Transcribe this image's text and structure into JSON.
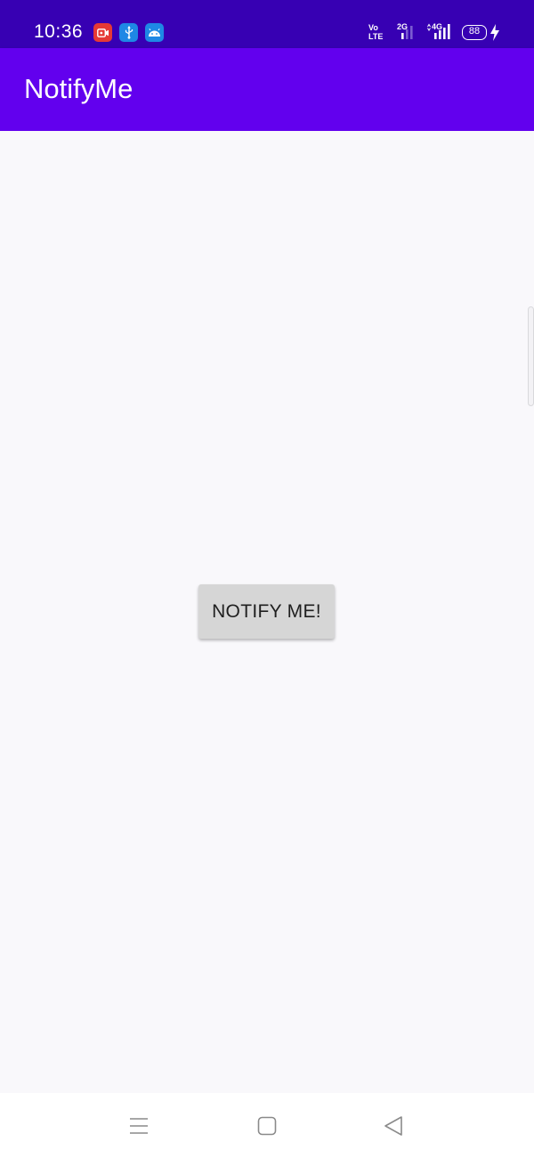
{
  "status_bar": {
    "time": "10:36",
    "notification_icons": [
      "screen-record-icon",
      "usb-icon",
      "android-icon"
    ],
    "volte_top": "Vo",
    "volte_bottom": "LTE",
    "network_2g": "2G",
    "network_4g": "4G",
    "battery_level": "88",
    "colors": {
      "background": "#3700b3",
      "record": "#e53935",
      "usb": "#1e88e5",
      "android": "#1e88e5"
    }
  },
  "app_bar": {
    "title": "NotifyMe",
    "color": "#6200ee"
  },
  "main": {
    "notify_button_label": "NOTIFY ME!"
  },
  "nav_bar": {
    "buttons": [
      "menu-icon",
      "home-icon",
      "back-icon"
    ]
  }
}
